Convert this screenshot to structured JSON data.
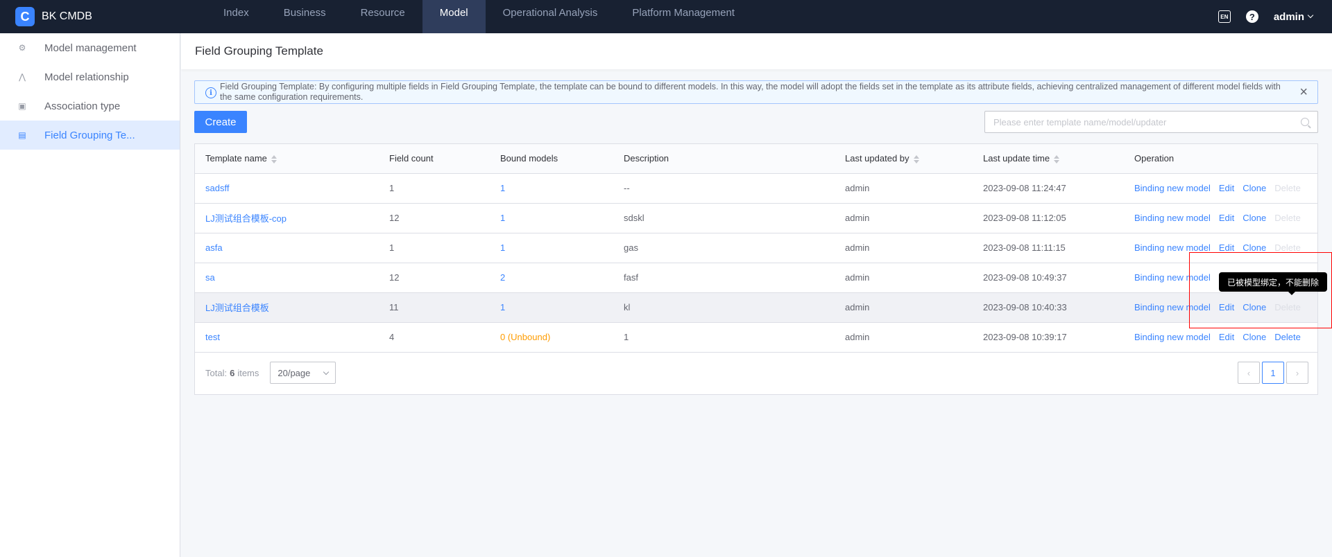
{
  "app": {
    "brand_logo": "C",
    "brand_name": "BK CMDB"
  },
  "nav": {
    "items": [
      "Index",
      "Business",
      "Resource",
      "Model",
      "Operational Analysis",
      "Platform Management"
    ],
    "active": "Model"
  },
  "topbar": {
    "lang_label": "EN",
    "help_label": "?",
    "user": "admin"
  },
  "sidebar": {
    "items": [
      {
        "label": "Model management",
        "icon": "model-management-icon"
      },
      {
        "label": "Model relationship",
        "icon": "model-relationship-icon"
      },
      {
        "label": "Association type",
        "icon": "association-type-icon"
      },
      {
        "label": "Field Grouping Te...",
        "icon": "field-grouping-icon"
      }
    ],
    "active_index": 3
  },
  "page": {
    "title": "Field Grouping Template"
  },
  "notice": {
    "text": "Field Grouping Template: By configuring multiple fields in Field Grouping Template, the template can be bound to different models. In this way, the model will adopt the fields set in the template as its attribute fields, achieving centralized management of different model fields with the same configuration requirements.",
    "close": "×"
  },
  "toolbar": {
    "create_label": "Create",
    "search_placeholder": "Please enter template name/model/updater"
  },
  "table": {
    "headers": [
      "Template name",
      "Field count",
      "Bound models",
      "Description",
      "Last updated by",
      "Last update time",
      "Operation"
    ],
    "rows": [
      {
        "name": "sadsff",
        "field_count": "1",
        "bound_models": "1",
        "description": "--",
        "updater": "admin",
        "update_time": "2023-09-08 11:24:47",
        "delete_enabled": false
      },
      {
        "name": "LJ测试组合模板-cop",
        "field_count": "12",
        "bound_models": "1",
        "description": "sdskl",
        "updater": "admin",
        "update_time": "2023-09-08 11:12:05",
        "delete_enabled": false
      },
      {
        "name": "asfa",
        "field_count": "1",
        "bound_models": "1",
        "description": "gas",
        "updater": "admin",
        "update_time": "2023-09-08 11:11:15",
        "delete_enabled": false
      },
      {
        "name": "sa",
        "field_count": "12",
        "bound_models": "2",
        "description": "fasf",
        "updater": "admin",
        "update_time": "2023-09-08 10:49:37",
        "delete_enabled": false
      },
      {
        "name": "LJ测试组合模板",
        "field_count": "11",
        "bound_models": "1",
        "description": "kl",
        "updater": "admin",
        "update_time": "2023-09-08 10:40:33",
        "delete_enabled": false
      },
      {
        "name": "test",
        "field_count": "4",
        "bound_models": "0 (Unbound)",
        "description": "1",
        "updater": "admin",
        "update_time": "2023-09-08 10:39:17",
        "delete_enabled": true
      }
    ],
    "operations": [
      "Binding new model",
      "Edit",
      "Clone",
      "Delete"
    ],
    "hover_row": 4
  },
  "pagination": {
    "total_label": "Total:",
    "total_count": "6",
    "items_label": "items",
    "page_size": "20/page",
    "prev": "‹",
    "current_page": "1",
    "next": "›"
  },
  "tooltip": {
    "text": "已被模型绑定，不能删除"
  },
  "colors": {
    "primary": "#3a84ff",
    "topbar": "#182132",
    "warning": "#ff9c01",
    "disabled": "#dcdee5"
  }
}
